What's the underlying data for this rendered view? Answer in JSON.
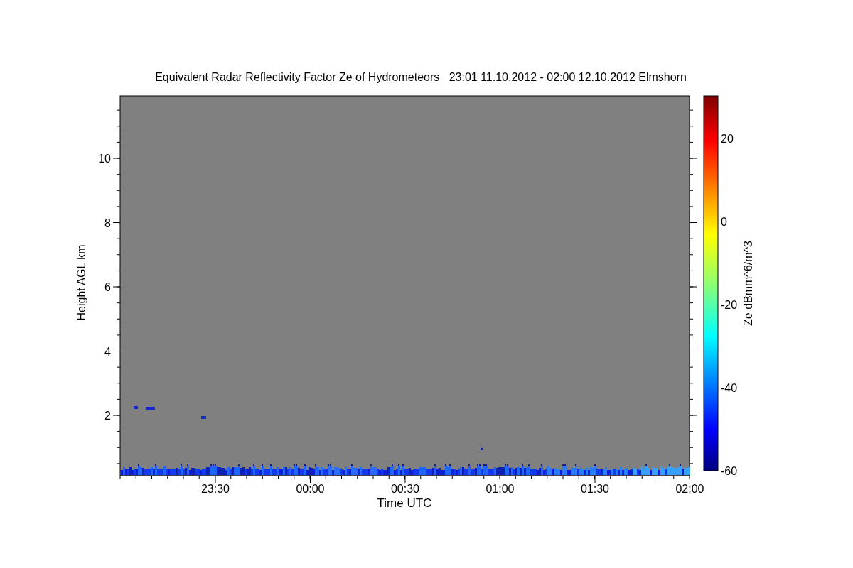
{
  "title": "Equivalent Radar Reflectivity Factor Ze of Hydrometeors   23:01 11.10.2012 - 02:00 12.10.2012 Elmshorn",
  "plot": {
    "xlabel": "Time UTC",
    "ylabel": "Height AGL km",
    "xticks": [
      "23:30",
      "00:00",
      "00:30",
      "01:00",
      "01:30",
      "02:00"
    ],
    "yticks": [
      "10",
      "8",
      "6",
      "4",
      "2"
    ]
  },
  "colorbar": {
    "label": "Ze dBmm^6/m^3",
    "ticks": [
      "20",
      "0",
      "-20",
      "-40",
      "-60"
    ]
  }
}
